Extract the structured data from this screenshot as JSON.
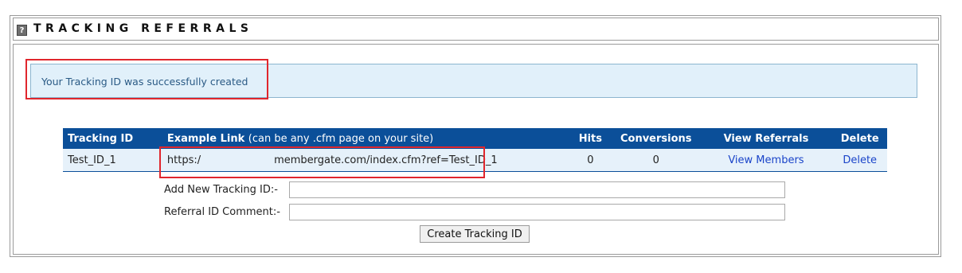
{
  "header": {
    "help_glyph": "?",
    "title": "TRACKING REFERRALS"
  },
  "notice": {
    "message": "Your Tracking ID was successfully created"
  },
  "table": {
    "columns": {
      "tracking_id": "Tracking ID",
      "example_link": "Example Link",
      "example_link_note": "(can be any .cfm page on your site)",
      "hits": "Hits",
      "conversions": "Conversions",
      "view_referrals": "View Referrals",
      "delete": "Delete"
    },
    "rows": [
      {
        "tracking_id": "Test_ID_1",
        "link_prefix": "https:/",
        "link_suffix": "membergate.com/index.cfm?ref=Test_ID_1",
        "hits": "0",
        "conversions": "0",
        "view_label": "View Members",
        "delete_label": "Delete"
      }
    ]
  },
  "form": {
    "new_id_label": "Add New Tracking ID:-",
    "new_id_value": "",
    "comment_label": "Referral ID Comment:-",
    "comment_value": "",
    "submit_label": "Create Tracking ID"
  },
  "colors": {
    "header_bg": "#0b4f99",
    "row_bg": "#e6f1fa",
    "notice_bg": "#e1f0fa",
    "link": "#1a44c9",
    "highlight": "#e0262d"
  }
}
